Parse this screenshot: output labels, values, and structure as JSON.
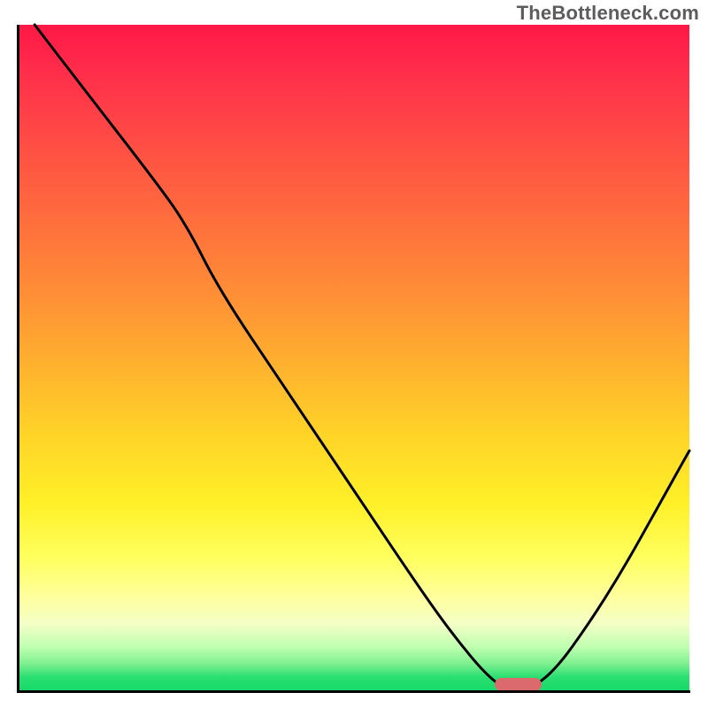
{
  "watermark": "TheBottleneck.com",
  "colors": {
    "curve": "#000000",
    "marker": "#da6a6e",
    "gradient_top": "#ff1846",
    "gradient_bottom": "#17d968"
  },
  "chart_data": {
    "type": "line",
    "title": "",
    "xlabel": "",
    "ylabel": "",
    "xlim": [
      0,
      100
    ],
    "ylim": [
      0,
      100
    ],
    "series": [
      {
        "name": "bottleneck-curve",
        "x": [
          2.4,
          10,
          20,
          25,
          30,
          40,
          50,
          60,
          65,
          70,
          73,
          76,
          80,
          85,
          90,
          95,
          100
        ],
        "values": [
          100,
          90,
          77,
          70,
          60,
          45,
          30,
          15,
          8,
          2,
          0,
          0,
          3,
          10,
          18,
          27,
          36
        ]
      }
    ],
    "annotations": [
      {
        "name": "optimal-marker",
        "x_range": [
          71,
          78
        ],
        "y": 0.8
      }
    ]
  }
}
